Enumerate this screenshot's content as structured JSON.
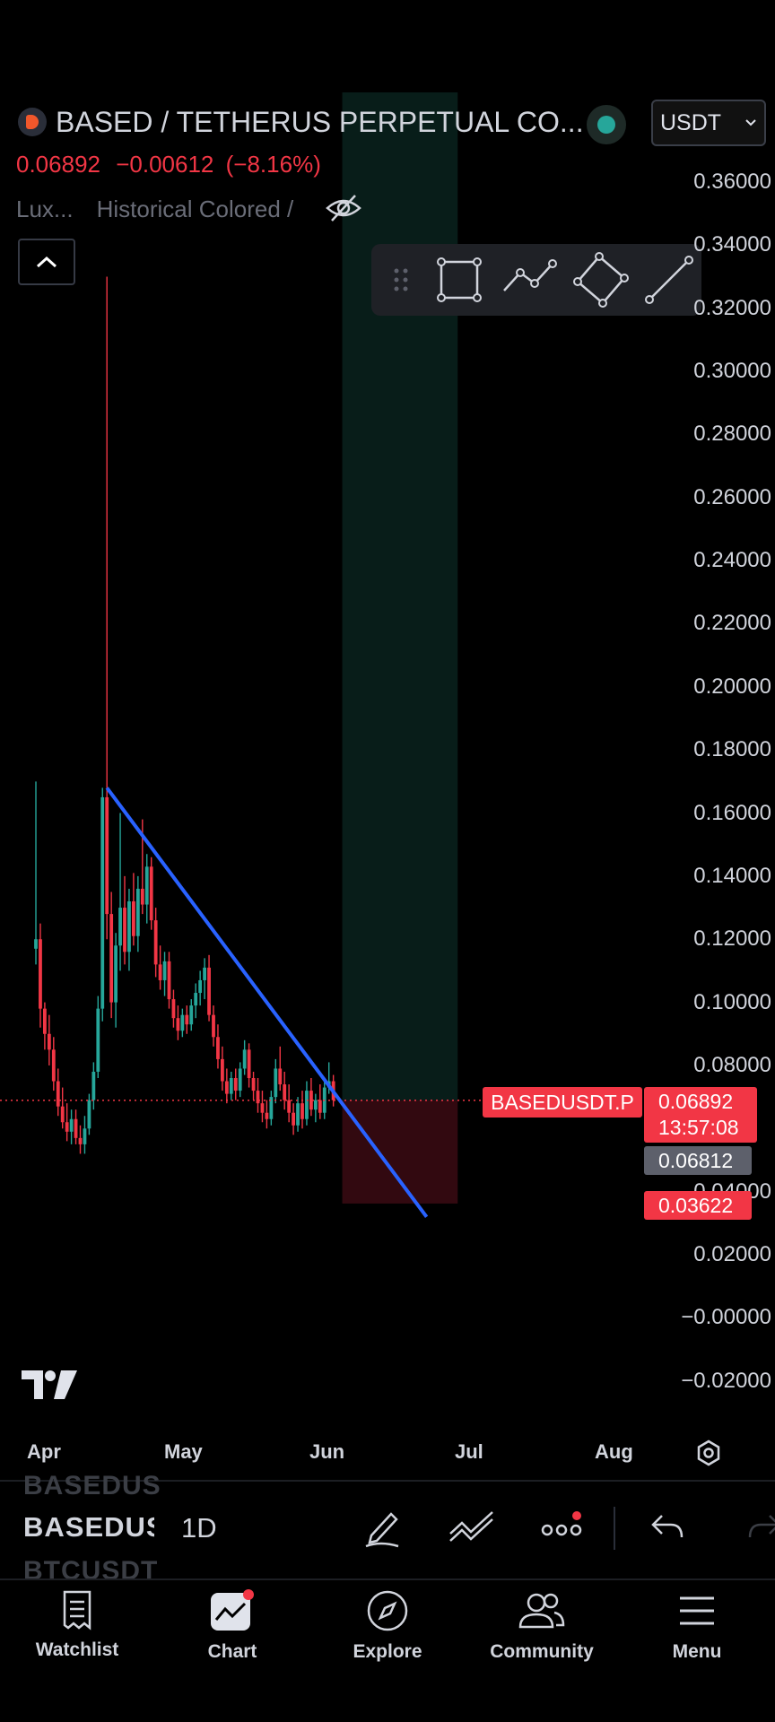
{
  "header": {
    "symbol_title": "BASED / TETHERUS PERPETUAL CO...",
    "currency": "USDT",
    "last_price": "0.06892",
    "change": "−0.00612",
    "change_pct": "(−8.16%)",
    "indicator_1": "Lux...",
    "indicator_2": "Historical Colored /"
  },
  "chart_data": {
    "type": "candlestick",
    "symbol": "BASEDUSDT.P",
    "interval": "1D",
    "x_axis_ticks": [
      "Apr",
      "May",
      "Jun",
      "Jul",
      "Aug"
    ],
    "y_axis_ticks": [
      "0.36000",
      "0.34000",
      "0.32000",
      "0.30000",
      "0.28000",
      "0.26000",
      "0.24000",
      "0.22000",
      "0.20000",
      "0.18000",
      "0.16000",
      "0.14000",
      "0.12000",
      "0.10000",
      "0.08000",
      "0.04000",
      "0.02000",
      "−0.00000",
      "−0.02000"
    ],
    "ylim": [
      -0.022,
      0.37
    ],
    "current_price": 0.06892,
    "candles": [
      {
        "o": 0.117,
        "h": 0.17,
        "l": 0.112,
        "c": 0.12
      },
      {
        "o": 0.12,
        "h": 0.125,
        "l": 0.092,
        "c": 0.098
      },
      {
        "o": 0.098,
        "h": 0.1,
        "l": 0.085,
        "c": 0.09
      },
      {
        "o": 0.09,
        "h": 0.096,
        "l": 0.08,
        "c": 0.085
      },
      {
        "o": 0.085,
        "h": 0.089,
        "l": 0.072,
        "c": 0.075
      },
      {
        "o": 0.075,
        "h": 0.079,
        "l": 0.064,
        "c": 0.067
      },
      {
        "o": 0.067,
        "h": 0.073,
        "l": 0.06,
        "c": 0.062
      },
      {
        "o": 0.062,
        "h": 0.068,
        "l": 0.056,
        "c": 0.059
      },
      {
        "o": 0.059,
        "h": 0.066,
        "l": 0.055,
        "c": 0.063
      },
      {
        "o": 0.063,
        "h": 0.066,
        "l": 0.055,
        "c": 0.057
      },
      {
        "o": 0.057,
        "h": 0.061,
        "l": 0.052,
        "c": 0.055
      },
      {
        "o": 0.055,
        "h": 0.064,
        "l": 0.052,
        "c": 0.06
      },
      {
        "o": 0.06,
        "h": 0.071,
        "l": 0.058,
        "c": 0.069
      },
      {
        "o": 0.069,
        "h": 0.081,
        "l": 0.066,
        "c": 0.078
      },
      {
        "o": 0.078,
        "h": 0.102,
        "l": 0.076,
        "c": 0.098
      },
      {
        "o": 0.098,
        "h": 0.168,
        "l": 0.094,
        "c": 0.165
      },
      {
        "o": 0.165,
        "h": 0.33,
        "l": 0.12,
        "c": 0.128
      },
      {
        "o": 0.128,
        "h": 0.135,
        "l": 0.095,
        "c": 0.1
      },
      {
        "o": 0.1,
        "h": 0.122,
        "l": 0.092,
        "c": 0.118
      },
      {
        "o": 0.118,
        "h": 0.16,
        "l": 0.11,
        "c": 0.13
      },
      {
        "o": 0.13,
        "h": 0.14,
        "l": 0.112,
        "c": 0.116
      },
      {
        "o": 0.116,
        "h": 0.136,
        "l": 0.11,
        "c": 0.132
      },
      {
        "o": 0.132,
        "h": 0.141,
        "l": 0.118,
        "c": 0.121
      },
      {
        "o": 0.121,
        "h": 0.14,
        "l": 0.116,
        "c": 0.136
      },
      {
        "o": 0.136,
        "h": 0.158,
        "l": 0.128,
        "c": 0.131
      },
      {
        "o": 0.131,
        "h": 0.147,
        "l": 0.125,
        "c": 0.143
      },
      {
        "o": 0.143,
        "h": 0.146,
        "l": 0.123,
        "c": 0.126
      },
      {
        "o": 0.126,
        "h": 0.13,
        "l": 0.108,
        "c": 0.112
      },
      {
        "o": 0.112,
        "h": 0.118,
        "l": 0.104,
        "c": 0.107
      },
      {
        "o": 0.107,
        "h": 0.116,
        "l": 0.102,
        "c": 0.113
      },
      {
        "o": 0.113,
        "h": 0.116,
        "l": 0.098,
        "c": 0.101
      },
      {
        "o": 0.101,
        "h": 0.104,
        "l": 0.092,
        "c": 0.095
      },
      {
        "o": 0.095,
        "h": 0.099,
        "l": 0.088,
        "c": 0.091
      },
      {
        "o": 0.091,
        "h": 0.098,
        "l": 0.089,
        "c": 0.096
      },
      {
        "o": 0.096,
        "h": 0.099,
        "l": 0.09,
        "c": 0.093
      },
      {
        "o": 0.093,
        "h": 0.101,
        "l": 0.091,
        "c": 0.099
      },
      {
        "o": 0.099,
        "h": 0.106,
        "l": 0.095,
        "c": 0.103
      },
      {
        "o": 0.103,
        "h": 0.11,
        "l": 0.099,
        "c": 0.107
      },
      {
        "o": 0.107,
        "h": 0.114,
        "l": 0.101,
        "c": 0.111
      },
      {
        "o": 0.111,
        "h": 0.115,
        "l": 0.094,
        "c": 0.096
      },
      {
        "o": 0.096,
        "h": 0.099,
        "l": 0.086,
        "c": 0.089
      },
      {
        "o": 0.089,
        "h": 0.093,
        "l": 0.079,
        "c": 0.082
      },
      {
        "o": 0.082,
        "h": 0.086,
        "l": 0.072,
        "c": 0.075
      },
      {
        "o": 0.075,
        "h": 0.079,
        "l": 0.068,
        "c": 0.071
      },
      {
        "o": 0.071,
        "h": 0.078,
        "l": 0.069,
        "c": 0.076
      },
      {
        "o": 0.076,
        "h": 0.079,
        "l": 0.069,
        "c": 0.072
      },
      {
        "o": 0.072,
        "h": 0.081,
        "l": 0.07,
        "c": 0.079
      },
      {
        "o": 0.079,
        "h": 0.088,
        "l": 0.077,
        "c": 0.085
      },
      {
        "o": 0.085,
        "h": 0.087,
        "l": 0.073,
        "c": 0.076
      },
      {
        "o": 0.076,
        "h": 0.078,
        "l": 0.069,
        "c": 0.072
      },
      {
        "o": 0.072,
        "h": 0.076,
        "l": 0.065,
        "c": 0.068
      },
      {
        "o": 0.068,
        "h": 0.072,
        "l": 0.062,
        "c": 0.065
      },
      {
        "o": 0.065,
        "h": 0.069,
        "l": 0.06,
        "c": 0.063
      },
      {
        "o": 0.063,
        "h": 0.072,
        "l": 0.061,
        "c": 0.07
      },
      {
        "o": 0.07,
        "h": 0.082,
        "l": 0.068,
        "c": 0.079
      },
      {
        "o": 0.079,
        "h": 0.086,
        "l": 0.072,
        "c": 0.074
      },
      {
        "o": 0.074,
        "h": 0.078,
        "l": 0.066,
        "c": 0.069
      },
      {
        "o": 0.069,
        "h": 0.074,
        "l": 0.062,
        "c": 0.065
      },
      {
        "o": 0.065,
        "h": 0.068,
        "l": 0.058,
        "c": 0.061
      },
      {
        "o": 0.061,
        "h": 0.07,
        "l": 0.059,
        "c": 0.068
      },
      {
        "o": 0.068,
        "h": 0.072,
        "l": 0.06,
        "c": 0.063
      },
      {
        "o": 0.063,
        "h": 0.075,
        "l": 0.061,
        "c": 0.072
      },
      {
        "o": 0.072,
        "h": 0.076,
        "l": 0.064,
        "c": 0.066
      },
      {
        "o": 0.066,
        "h": 0.071,
        "l": 0.062,
        "c": 0.069
      },
      {
        "o": 0.069,
        "h": 0.074,
        "l": 0.063,
        "c": 0.065
      },
      {
        "o": 0.065,
        "h": 0.076,
        "l": 0.063,
        "c": 0.073
      },
      {
        "o": 0.073,
        "h": 0.081,
        "l": 0.071,
        "c": 0.075
      },
      {
        "o": 0.075,
        "h": 0.077,
        "l": 0.067,
        "c": 0.069
      }
    ],
    "trendline": {
      "from": {
        "index": 16,
        "price": 0.168
      },
      "to": {
        "index": 88,
        "price": 0.032
      }
    },
    "position": {
      "entry": 0.06892,
      "target": 0.36,
      "stop": 0.03622,
      "start_index": 69,
      "end_index": 95
    }
  },
  "price_badges": {
    "symbol_label": "BASEDUSDT.P",
    "price": "0.06892",
    "countdown": "13:57:08",
    "grey_price": "0.06812",
    "stop_price": "0.03622"
  },
  "drawing_toolbar": {
    "tools": [
      "rectangle-icon",
      "path-icon",
      "parallel-channel-icon",
      "trend-line-icon"
    ]
  },
  "bottom_bar": {
    "ghost_top": "BASEDUS",
    "symbol": "BASEDUSDT.P",
    "interval": "1D",
    "ghost_bottom": "BTCUSDT"
  },
  "nav": {
    "items": [
      {
        "label": "Watchlist",
        "icon": "watchlist-icon"
      },
      {
        "label": "Chart",
        "icon": "chart-icon"
      },
      {
        "label": "Explore",
        "icon": "compass-icon"
      },
      {
        "label": "Community",
        "icon": "community-icon"
      },
      {
        "label": "Menu",
        "icon": "menu-icon"
      }
    ]
  },
  "colors": {
    "up": "#26a69a",
    "down": "#f23645",
    "trendline": "#2962ff",
    "background": "#000000"
  }
}
